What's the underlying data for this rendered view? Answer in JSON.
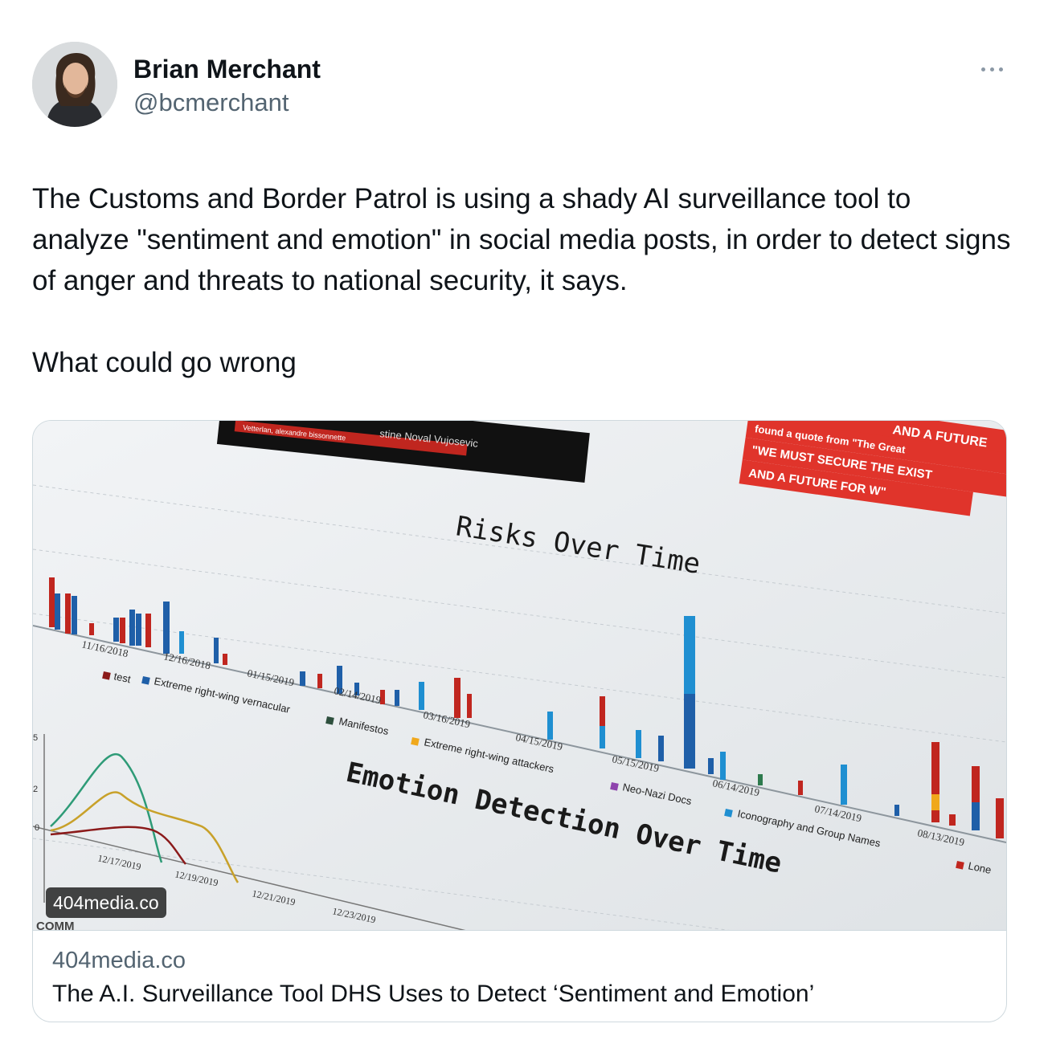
{
  "author": {
    "name": "Brian Merchant",
    "handle": "@bcmerchant"
  },
  "tweet": {
    "text": "The Customs and Border Patrol is using a shady AI surveillance tool to analyze \"sentiment and emotion\" in social media posts, in order to detect signs of anger and threats to national security, it says.\n\nWhat could go wrong"
  },
  "link_card": {
    "domain_badge": "404media.co",
    "domain": "404media.co",
    "title": "The A.I. Surveillance Tool DHS Uses to Detect ‘Sentiment and Emotion’",
    "image": {
      "chart_title_1": "Risks Over Time",
      "chart_title_2": "Emotion Detection Over Time",
      "dates_top": [
        "11/16/2018",
        "12/16/2018",
        "01/15/2019",
        "02/14/2019",
        "03/16/2019",
        "04/15/2019",
        "05/15/2019",
        "06/14/2019",
        "07/14/2019",
        "08/13/2019"
      ],
      "legend": [
        "test",
        "Extreme right-wing vernacular",
        "Manifestos",
        "Extreme right-wing attackers",
        "Neo-Nazi Docs",
        "Iconography and Group Names",
        "Lone"
      ],
      "dates_bottom": [
        "12/17/2019",
        "12/19/2019",
        "12/21/2019",
        "12/23/2019"
      ],
      "banner_top_left": "stine Noval Vujosevic",
      "banner_top_left_sub": "Vetterlan, alexandre bissonnette",
      "banner_red": [
        "AND A FUTURE",
        "found a quote from \"The Great",
        "\"WE MUST SECURE THE EXIST",
        "AND A FUTURE FOR W\""
      ],
      "axis_ticks": [
        "5",
        "2",
        "0"
      ],
      "comm_label": "COMM"
    }
  },
  "icons": {
    "more": "more-horizontal-icon"
  }
}
